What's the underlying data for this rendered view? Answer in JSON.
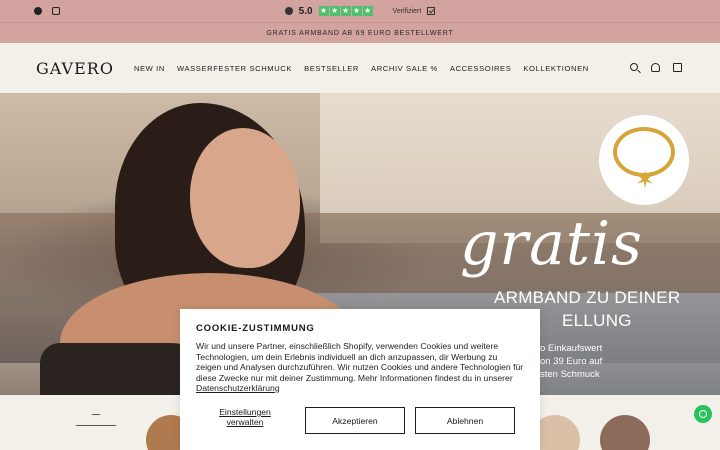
{
  "rating_bar": {
    "score": "5.0",
    "stars": [
      "★",
      "★",
      "★",
      "★",
      "★"
    ],
    "verified_label": "Verifiziert"
  },
  "promo": {
    "text": "GRATIS ARMBAND AB 69 EURO BESTELLWERT",
    "social": [
      "facebook-icon",
      "instagram-icon"
    ]
  },
  "header": {
    "logo": "GAVERO",
    "nav": [
      "NEW IN",
      "WASSERFESTER SCHMUCK",
      "BESTSELLER",
      "ARCHIV SALE %",
      "ACCESSOIRES",
      "KOLLEKTIONEN"
    ],
    "icons": [
      "search-icon",
      "account-icon",
      "cart-icon"
    ]
  },
  "hero": {
    "headline": "gratis",
    "sub_line1": "ARMBAND ZU DEINER",
    "sub_line2": "ELLUNG",
    "small_line1": "o Einkaufswert",
    "small_line2": "on 39 Euro auf",
    "small_line3": "sten Schmuck"
  },
  "cookie": {
    "title": "COOKIE-ZUSTIMMUNG",
    "text": "Wir und unsere Partner, einschließlich Shopify, verwenden Cookies und weitere Technologien, um dein Erlebnis individuell an dich anzupassen, dir Werbung zu zeigen und Analysen durchzuführen. Wir nutzen Cookies und andere Technologien für diese Zwecke nur mit deiner Zustimmung. Mehr Informationen findest du in unserer",
    "link": "Datenschutzerklärung",
    "settings_label": "Einstellungen verwalten",
    "accept_label": "Akzeptieren",
    "reject_label": "Ablehnen"
  },
  "colors": {
    "top_bar": "#d2a39f",
    "page_bg": "#f3efe9",
    "star_green": "#4ebf6d",
    "whatsapp": "#27c25a",
    "gold": "#d6a437"
  }
}
